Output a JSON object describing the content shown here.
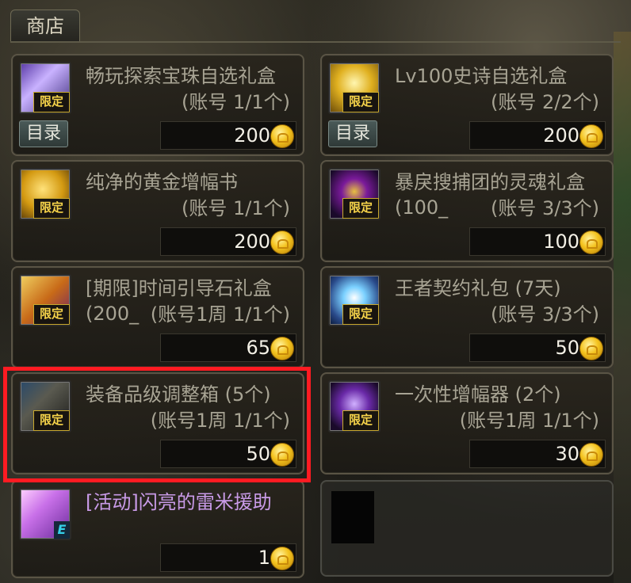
{
  "shop": {
    "title": "商店",
    "items": [
      {
        "name": "畅玩探索宝珠自选礼盒",
        "limit": "(账号 1/1个)",
        "price": "200",
        "badge": "限定",
        "catalog": "目录",
        "icon": "purple-orb-box-icon"
      },
      {
        "name": "Lv100史诗自选礼盒",
        "limit": "(账号 2/2个)",
        "price": "200",
        "badge": "限定",
        "catalog": "目录",
        "icon": "golden-epic-box-icon"
      },
      {
        "name": "纯净的黄金增幅书",
        "limit": "(账号 1/1个)",
        "price": "200",
        "badge": "限定",
        "icon": "golden-book-icon"
      },
      {
        "name": "暴戾搜捕团的灵魂礼盒 (100_",
        "limit": "(账号 3/3个)",
        "price": "100",
        "badge": "限定",
        "icon": "soul-box-icon"
      },
      {
        "name": "[期限]时间引导石礼盒 (200_",
        "limit": "(账号1周 1/1个)",
        "price": "65",
        "badge": "限定",
        "icon": "time-stone-box-icon"
      },
      {
        "name": "王者契约礼包 (7天)",
        "limit": "(账号 3/3个)",
        "price": "50",
        "badge": "限定",
        "icon": "king-contract-icon"
      },
      {
        "name": "装备品级调整箱 (5个)",
        "limit": "(账号1周 1/1个)",
        "price": "50",
        "badge": "限定",
        "icon": "equipment-grade-box-icon"
      },
      {
        "name": "一次性增幅器 (2个)",
        "limit": "(账号1周 1/1个)",
        "price": "30",
        "badge": "限定",
        "icon": "amplifier-icon"
      },
      {
        "name": "[活动]闪亮的雷米援助",
        "limit": "",
        "price": "1",
        "badge": "E",
        "icon": "shiny-remy-icon"
      }
    ]
  },
  "colors": {
    "gold": "#f4c31e",
    "highlight": "#ff1b22",
    "badge_text": "#f6d34a"
  }
}
